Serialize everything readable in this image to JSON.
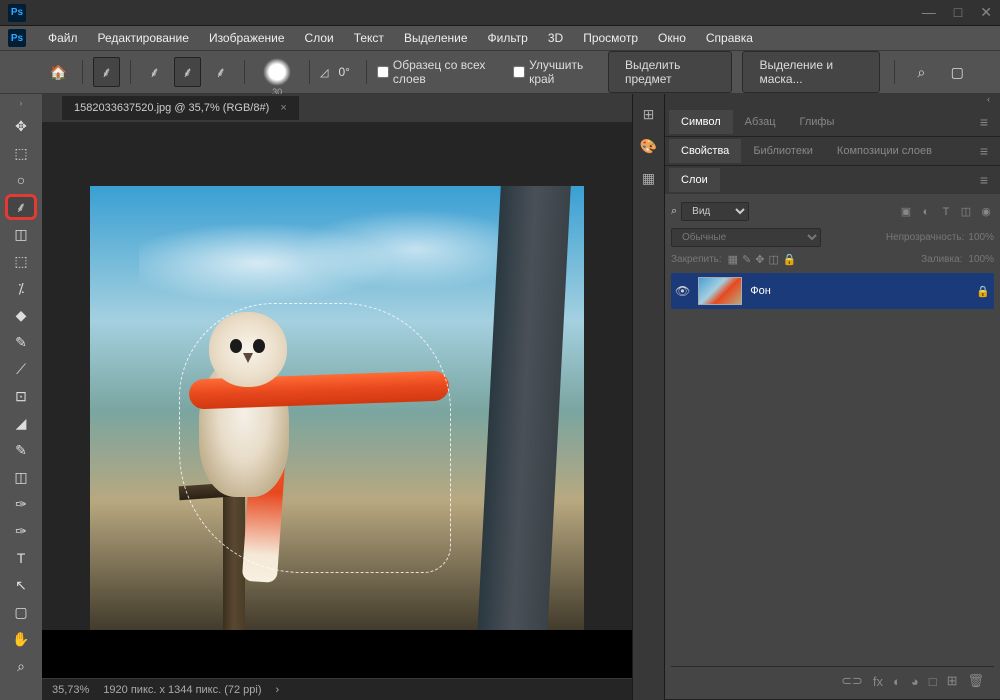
{
  "app": {
    "icon": "Ps"
  },
  "window": {
    "min": "—",
    "max": "□",
    "close": "✕"
  },
  "menu": [
    "Файл",
    "Редактирование",
    "Изображение",
    "Слои",
    "Текст",
    "Выделение",
    "Фильтр",
    "3D",
    "Просмотр",
    "Окно",
    "Справка"
  ],
  "options": {
    "brush_size": "30",
    "angle": "0°",
    "sample_all": "Образец со всех слоев",
    "refine_edge": "Улучшить край",
    "select_subject": "Выделить предмет",
    "select_and_mask": "Выделение и маска...",
    "search_icon": "⌕",
    "panel_icon": "▢"
  },
  "document": {
    "tab": "1582033637520.jpg @ 35,7% (RGB/8#)",
    "close": "×",
    "zoom": "35,73%",
    "dims": "1920 пикс. x 1344 пикс. (72 ppi)",
    "arrow": "›"
  },
  "panels": {
    "collapsed": [
      "⊞",
      "🎨",
      "▦"
    ],
    "row1": {
      "tabs": [
        "Символ",
        "Абзац",
        "Глифы"
      ],
      "active": 0
    },
    "row2": {
      "tabs": [
        "Свойства",
        "Библиотеки",
        "Композиции слоев"
      ],
      "active": 0
    },
    "row3": {
      "tabs": [
        "Слои"
      ],
      "active": 0
    }
  },
  "layers": {
    "filter_kind": "Вид",
    "filter_search": "⌕",
    "filter_icons": [
      "▣",
      "◐",
      "T",
      "◫",
      "◉"
    ],
    "blend": "Обычные",
    "opacity_label": "Непрозрачность:",
    "opacity": "100%",
    "lock_label": "Закрепить:",
    "lock_icons": [
      "▦",
      "✎",
      "✥",
      "◫",
      "🔒"
    ],
    "fill_label": "Заливка:",
    "fill": "100%",
    "layer": {
      "name": "Фон",
      "locked": "🔒"
    },
    "footer": [
      "⊂⊃",
      "fx",
      "◐",
      "◕",
      "□",
      "⊞",
      "🗑"
    ]
  },
  "tools": [
    "✥",
    "⬚",
    "○",
    "⸙",
    "◫",
    "⬚",
    "⁒",
    "◆",
    "✎",
    "⟋",
    "⊡",
    "◢",
    "✎",
    "◫",
    "✑",
    "T",
    "↖",
    "▢",
    "✋",
    "⌕"
  ]
}
